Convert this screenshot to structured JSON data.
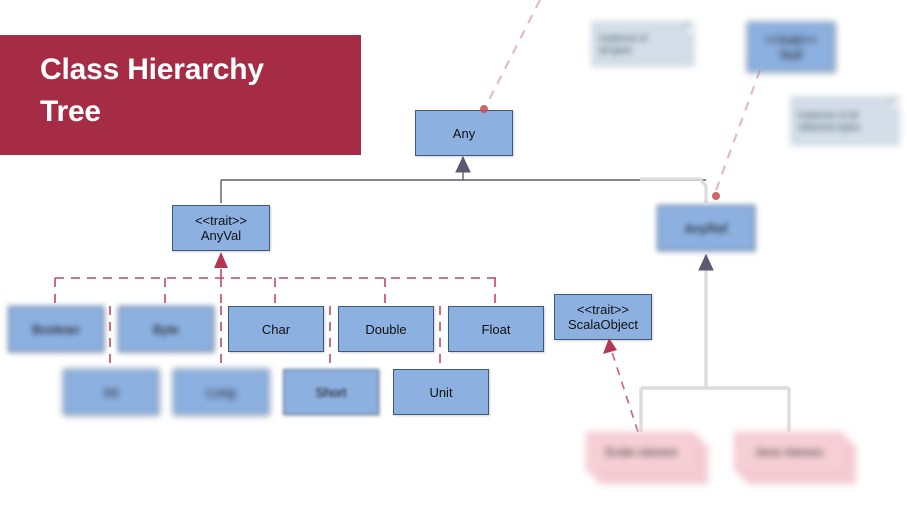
{
  "banner": {
    "title": "Class Hierarchy\nTree",
    "background_color": "#A62B44",
    "text_color": "#FFFFFF"
  },
  "colors": {
    "node_fill": "#8CB0E0",
    "node_border": "#41587A",
    "note_fill": "#D3DEE8",
    "note_border": "#9FB2C0",
    "stack_fill": "#F6CFD6",
    "dashed_connector": "#C0485F",
    "solid_connector": "#4A4A63",
    "pale_connector": "#DCDCDC"
  },
  "diagram": {
    "root": {
      "label": "Any"
    },
    "anyval": {
      "label": "<<trait>>\nAnyVal"
    },
    "anyref": {
      "label": "AnyRef"
    },
    "scalaobject": {
      "label": "<<trait>>\nScalaObject"
    },
    "value_types_row1": [
      {
        "label": "Boolean"
      },
      {
        "label": "Byte"
      },
      {
        "label": "Char"
      },
      {
        "label": "Double"
      },
      {
        "label": "Float"
      }
    ],
    "value_types_row2": [
      {
        "label": "Int"
      },
      {
        "label": "Long"
      },
      {
        "label": "Short"
      },
      {
        "label": "Unit"
      }
    ],
    "class_stacks": [
      {
        "label": "Scala classes"
      },
      {
        "label": "Java classes"
      }
    ],
    "notes": [
      {
        "label": "Instances of\nall types"
      },
      {
        "label": "Instances of all\nreference types"
      }
    ],
    "trait_note_node": {
      "label": "<<trait>>\nNull"
    }
  }
}
